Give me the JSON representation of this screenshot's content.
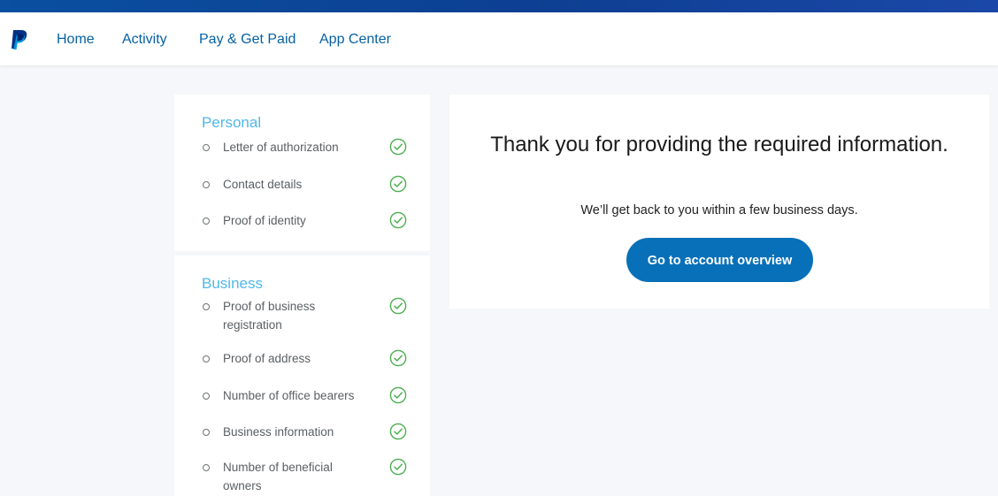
{
  "nav": {
    "logo_icon": "paypal-logo",
    "links": [
      "Home",
      "Activity",
      "Pay & Get Paid",
      "App Center"
    ]
  },
  "sidebar": {
    "personal": {
      "title": "Personal",
      "items": [
        {
          "label": "Letter of authorization",
          "status": "complete"
        },
        {
          "label": "Contact details",
          "status": "complete"
        },
        {
          "label": "Proof of identity",
          "status": "complete"
        }
      ]
    },
    "business": {
      "title": "Business",
      "items": [
        {
          "label": "Proof of business registration",
          "status": "complete"
        },
        {
          "label": "Proof of address",
          "status": "complete"
        },
        {
          "label": "Number of office bearers",
          "status": "complete"
        },
        {
          "label": "Business information",
          "status": "complete"
        },
        {
          "label": "Number of beneficial owners",
          "status": "complete"
        }
      ]
    }
  },
  "main": {
    "heading": "Thank you for providing the required information.",
    "subtext": "We’ll get back to you within a few business days.",
    "button_label": "Go to account overview"
  },
  "colors": {
    "brand_blue": "#0561a4",
    "button_blue": "#0870b8",
    "section_title": "#4fb8e8",
    "check_green": "#4caf50",
    "stripe": "#0d3f93"
  }
}
